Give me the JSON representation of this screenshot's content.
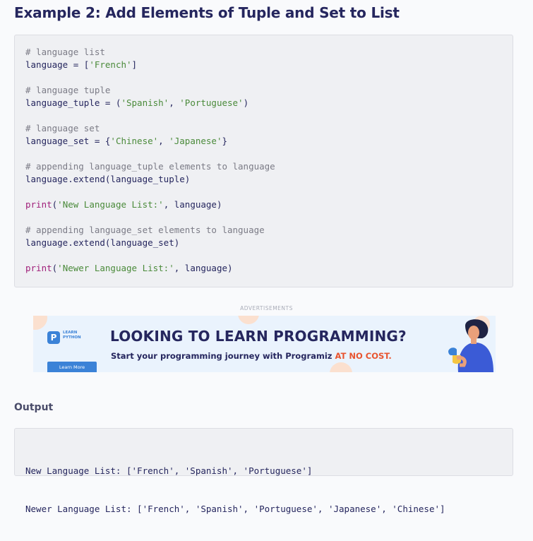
{
  "heading": "Example 2: Add Elements of Tuple and Set to List",
  "code": {
    "lines": [
      [
        {
          "t": "# language list",
          "c": "comment"
        }
      ],
      [
        {
          "t": "language = [",
          "c": "plain"
        },
        {
          "t": "'French'",
          "c": "string"
        },
        {
          "t": "]",
          "c": "plain"
        }
      ],
      [],
      [
        {
          "t": "# language tuple",
          "c": "comment"
        }
      ],
      [
        {
          "t": "language_tuple = (",
          "c": "plain"
        },
        {
          "t": "'Spanish'",
          "c": "string"
        },
        {
          "t": ", ",
          "c": "plain"
        },
        {
          "t": "'Portuguese'",
          "c": "string"
        },
        {
          "t": ")",
          "c": "plain"
        }
      ],
      [],
      [
        {
          "t": "# language set",
          "c": "comment"
        }
      ],
      [
        {
          "t": "language_set = {",
          "c": "plain"
        },
        {
          "t": "'Chinese'",
          "c": "string"
        },
        {
          "t": ", ",
          "c": "plain"
        },
        {
          "t": "'Japanese'",
          "c": "string"
        },
        {
          "t": "}",
          "c": "plain"
        }
      ],
      [],
      [
        {
          "t": "# appending language_tuple elements to language",
          "c": "comment"
        }
      ],
      [
        {
          "t": "language.extend(language_tuple)",
          "c": "plain"
        }
      ],
      [],
      [
        {
          "t": "print",
          "c": "keyword"
        },
        {
          "t": "(",
          "c": "plain"
        },
        {
          "t": "'New Language List:'",
          "c": "string"
        },
        {
          "t": ", language)",
          "c": "plain"
        }
      ],
      [],
      [
        {
          "t": "# appending language_set elements to language",
          "c": "comment"
        }
      ],
      [
        {
          "t": "language.extend(language_set)",
          "c": "plain"
        }
      ],
      [],
      [
        {
          "t": "print",
          "c": "keyword"
        },
        {
          "t": "(",
          "c": "plain"
        },
        {
          "t": "'Newer Language List:'",
          "c": "string"
        },
        {
          "t": ", language)",
          "c": "plain"
        }
      ]
    ]
  },
  "ads": {
    "label": "ADVERTISEMENTS",
    "logo_letter": "P",
    "logo_text": "LEARN\nPYTHON",
    "button_label": "Learn More",
    "title": "LOOKING TO LEARN PROGRAMMING?",
    "subtitle": "Start your programming journey with Programiz ",
    "subtitle_accent": "AT NO COST."
  },
  "output": {
    "title": "Output",
    "lines": [
      "New Language List: ['French', 'Spanish', 'Portuguese']",
      "Newer Language List: ['French', 'Spanish', 'Portuguese', 'Japanese', 'Chinese']"
    ]
  },
  "colors": {
    "heading": "#25265e",
    "comment": "#7b7b86",
    "string": "#4a8a3a",
    "keyword": "#a0207a",
    "accent": "#e8542f",
    "brand_blue": "#3b82d7"
  }
}
